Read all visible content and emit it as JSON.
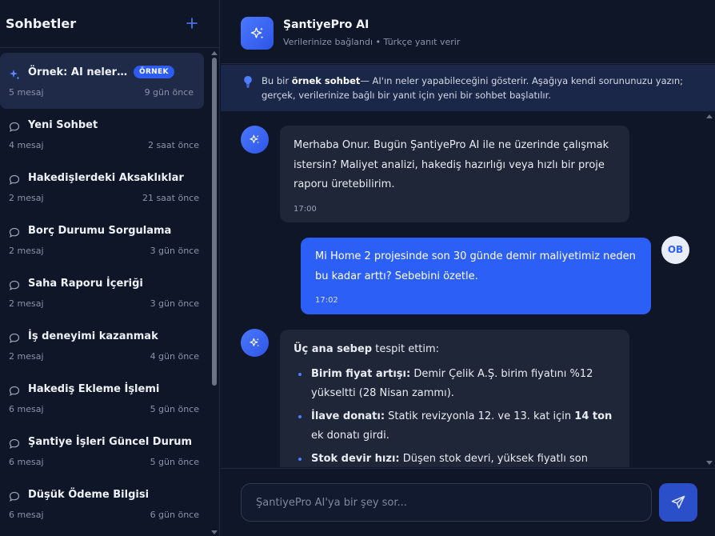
{
  "sidebar": {
    "title": "Sohbetler",
    "new_icon": "plus-icon",
    "conversations": [
      {
        "title": "Örnek: AI neler…",
        "badge": "ÖRNEK",
        "count": "5 mesaj",
        "time": "9 gün önce",
        "icon": "sparkle-icon"
      },
      {
        "title": "Yeni Sohbet",
        "count": "4 mesaj",
        "time": "2 saat önce",
        "icon": "chat-bubble-icon"
      },
      {
        "title": "Hakedişlerdeki Aksaklıklar",
        "count": "2 mesaj",
        "time": "21 saat önce",
        "icon": "chat-bubble-icon"
      },
      {
        "title": "Borç Durumu Sorgulama",
        "count": "2 mesaj",
        "time": "3 gün önce",
        "icon": "chat-bubble-icon"
      },
      {
        "title": "Saha Raporu İçeriği",
        "count": "2 mesaj",
        "time": "3 gün önce",
        "icon": "chat-bubble-icon"
      },
      {
        "title": "İş deneyimi kazanmak",
        "count": "2 mesaj",
        "time": "4 gün önce",
        "icon": "chat-bubble-icon"
      },
      {
        "title": "Hakediş Ekleme İşlemi",
        "count": "6 mesaj",
        "time": "5 gün önce",
        "icon": "chat-bubble-icon"
      },
      {
        "title": "Şantiye İşleri Güncel Durum",
        "count": "6 mesaj",
        "time": "5 gün önce",
        "icon": "chat-bubble-icon"
      },
      {
        "title": "Düşük Ödeme Bilgisi",
        "count": "6 mesaj",
        "time": "6 gün önce",
        "icon": "chat-bubble-icon"
      }
    ]
  },
  "header": {
    "title": "ŞantiyePro AI",
    "subtitle": "Verilerinize bağlandı • Türkçe yanıt verir",
    "icon": "sparkle-icon"
  },
  "notice": {
    "icon": "lightbulb-icon",
    "prefix": "Bu bir ",
    "bold": "örnek sohbet",
    "rest": "— AI'ın neler yapabileceğini gösterir. Aşağıya kendi sorununuzu yazın; gerçek, verilerinize bağlı bir yanıt için yeni bir sohbet başlatılır."
  },
  "messages": {
    "m1": {
      "text": "Merhaba Onur. Bugün ŞantiyePro AI ile ne üzerinde çalışmak istersin? Maliyet analizi, hakediş hazırlığı veya hızlı bir proje raporu üretebilirim.",
      "time": "17:00"
    },
    "m2": {
      "text": "Mi Home 2 projesinde son 30 günde demir maliyetimiz neden bu kadar arttı? Sebebini özetle.",
      "time": "17:02",
      "avatar": "OB"
    },
    "m3": {
      "intro_bold": "Üç ana sebep",
      "intro_rest": " tespit ettim:",
      "items": [
        {
          "bold": "Birim fiyat artışı:",
          "text": " Demir Çelik A.Ş. birim fiyatını %12 yükseltti (28 Nisan zammı)."
        },
        {
          "bold": "İlave donatı:",
          "text": " Statik revizyonla 12. ve 13. kat için ",
          "bold2": "14 ton",
          "text2": " ek donatı girdi."
        },
        {
          "bold": "Stok devir hızı:",
          "text": " Düşen stok devri, yüksek fiyatlı son"
        }
      ]
    }
  },
  "composer": {
    "placeholder": "ŞantiyePro AI'ya bir şey sor...",
    "send_icon": "send-icon"
  }
}
